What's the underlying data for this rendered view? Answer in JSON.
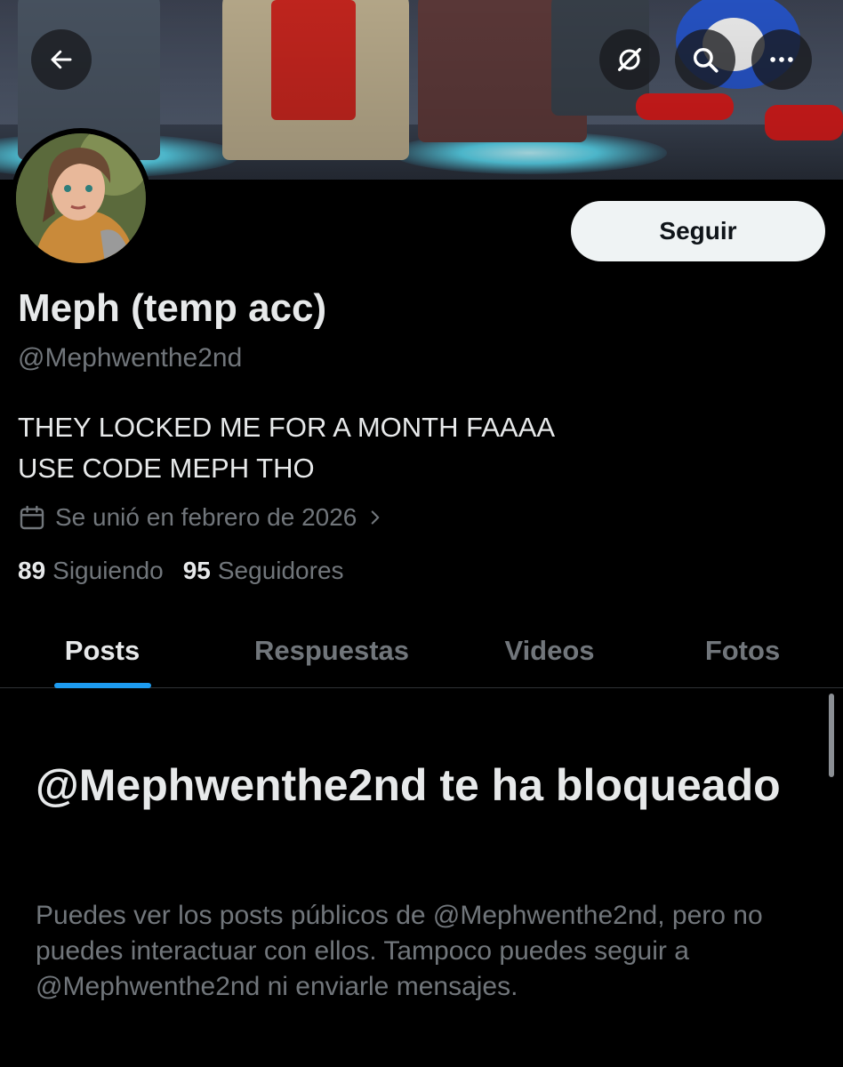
{
  "header": {
    "back_icon": "arrow-left-icon",
    "actions": [
      {
        "icon": "grok-slash-icon"
      },
      {
        "icon": "search-icon"
      },
      {
        "icon": "more-horizontal-icon"
      }
    ]
  },
  "profile": {
    "display_name": "Meph (temp acc)",
    "handle": "@Mephwenthe2nd",
    "bio_lines": [
      "THEY LOCKED ME FOR A MONTH FAAAA",
      "USE CODE MEPH THO"
    ],
    "joined": "Se unió en febrero de 2026",
    "following_count": "89",
    "following_label": "Siguiendo",
    "followers_count": "95",
    "followers_label": "Seguidores",
    "follow_button": "Seguir"
  },
  "tabs": [
    {
      "label": "Posts",
      "active": true
    },
    {
      "label": "Respuestas",
      "active": false
    },
    {
      "label": "Videos",
      "active": false
    },
    {
      "label": "Fotos",
      "active": false
    }
  ],
  "blocked": {
    "title": "@Mephwenthe2nd te ha bloqueado",
    "description": "Puedes ver los posts públicos de @Mephwenthe2nd, pero no puedes interactuar con ellos. Tampoco puedes seguir a @Mephwenthe2nd ni enviarle mensajes."
  },
  "colors": {
    "background": "#000000",
    "text_primary": "#e7e9ea",
    "text_secondary": "#71767b",
    "accent": "#1d9bf0",
    "follow_button_bg": "#eff3f4"
  }
}
